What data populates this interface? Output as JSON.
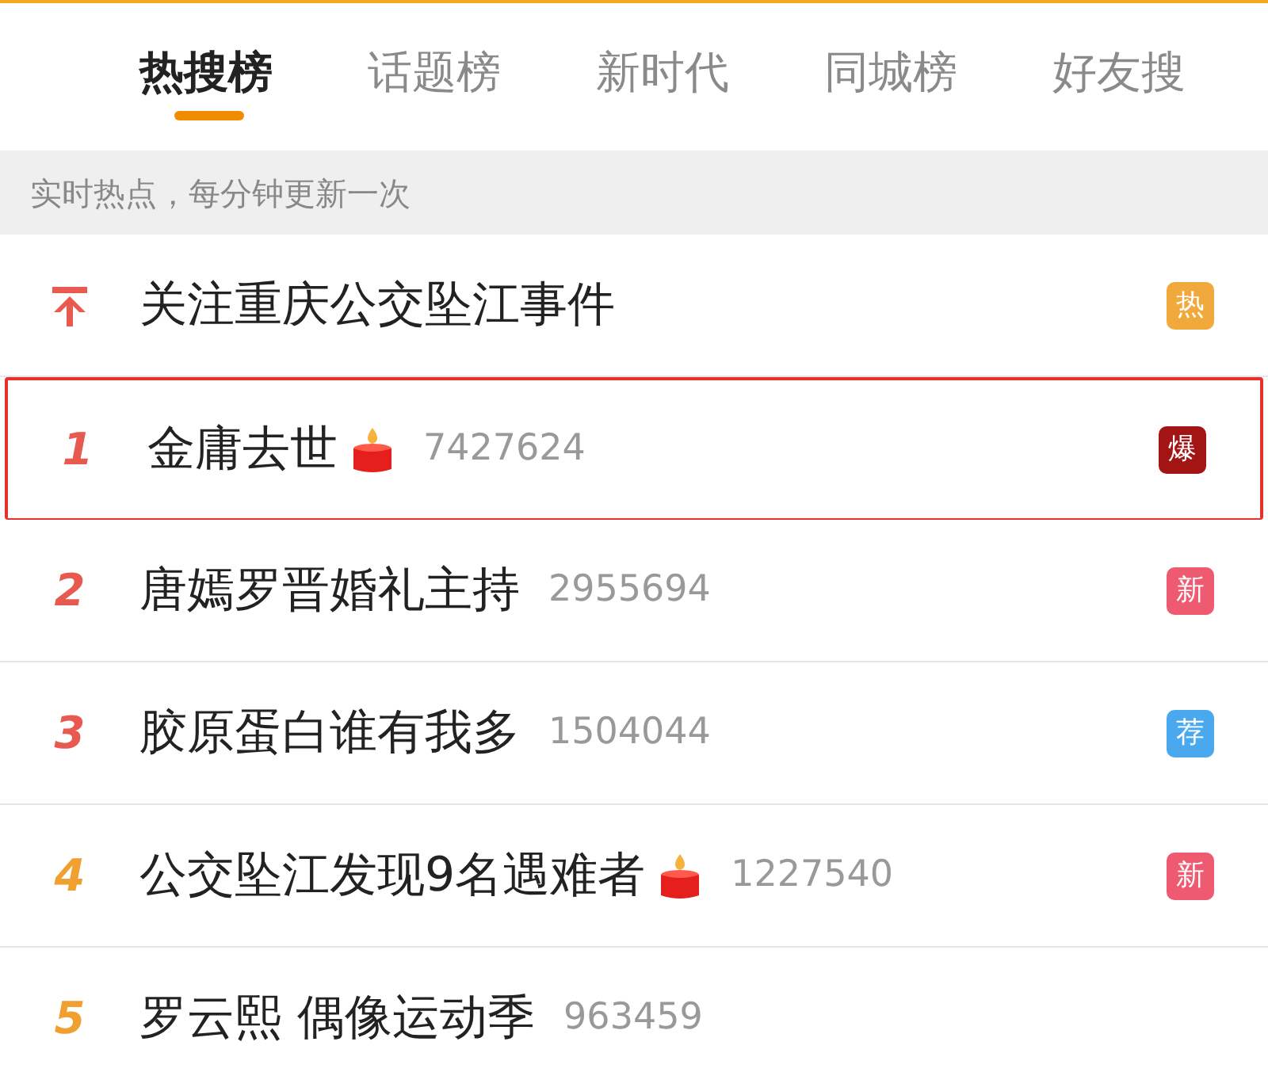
{
  "tabs": [
    {
      "label": "热搜榜",
      "selected": true
    },
    {
      "label": "话题榜",
      "selected": false
    },
    {
      "label": "新时代",
      "selected": false
    },
    {
      "label": "同城榜",
      "selected": false
    },
    {
      "label": "好友搜",
      "selected": false
    }
  ],
  "notice": "实时热点，每分钟更新一次",
  "rows": [
    {
      "kind": "pinned",
      "title": "关注重庆公交坠江事件",
      "candle": false,
      "badge": "热",
      "color": "#f2a93b",
      "highlighted": false
    },
    {
      "kind": "ranked",
      "rank": "1",
      "title": "金庸去世",
      "candle": true,
      "count": "7427624",
      "badge": "爆",
      "color": "#a31515",
      "highlighted": true
    },
    {
      "kind": "ranked",
      "rank": "2",
      "title": "唐嫣罗晋婚礼主持",
      "candle": false,
      "count": "2955694",
      "badge": "新",
      "color": "#ee5a6f",
      "highlighted": false
    },
    {
      "kind": "ranked",
      "rank": "3",
      "title": "胶原蛋白谁有我多",
      "candle": false,
      "count": "1504044",
      "badge": "荐",
      "color": "#4aa8ee",
      "highlighted": false
    },
    {
      "kind": "ranked",
      "rank": "4",
      "title": "公交坠江发现9名遇难者",
      "candle": true,
      "count": "1227540",
      "badge": "新",
      "color": "#ee5a6f",
      "highlighted": false
    },
    {
      "kind": "ranked",
      "rank": "5",
      "title": "罗云熙 偶像运动季",
      "candle": false,
      "count": "963459",
      "highlighted": false
    }
  ]
}
